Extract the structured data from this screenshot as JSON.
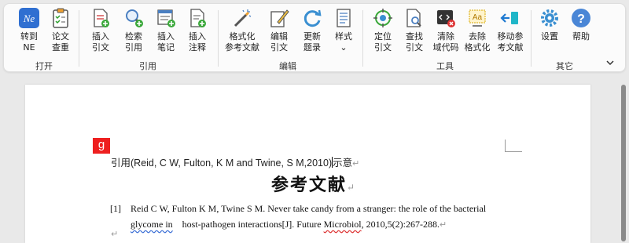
{
  "ribbon": {
    "groups": {
      "open": "打开",
      "cite": "引用",
      "edit": "编辑",
      "tools": "工具",
      "other": "其它"
    },
    "buttons": {
      "to_ne": "转到\nNE",
      "check_paper": "论文\n查重",
      "insert_cite": "插入\n引文",
      "search_cite": "检索\n引用",
      "insert_note": "插入\n笔记",
      "insert_annot": "插入\n注释",
      "format_refs": "格式化\n参考文献",
      "edit_cite": "编辑\n引文",
      "update_topics": "更新\n题录",
      "style": "样式\n⌄",
      "locate_cite": "定位\n引文",
      "find_cite": "查找\n引文",
      "clear_field": "清除\n域代码",
      "remove_format": "去除\n格式化",
      "move_refs": "移动参\n考文献",
      "settings": "设置",
      "help": "帮助"
    }
  },
  "document": {
    "field_marker": "g",
    "cite_line_pre": "引用(Reid, C W, Fulton, K M and Twine, S M,2010)",
    "cite_line_post": "示意",
    "para_mark": "↵",
    "heading": "参考文献",
    "ref_num": "[1]",
    "ref_text_1": "Reid C W, Fulton K M, Twine S M. Never take candy from a stranger: the role of the bacterial",
    "ref_text_2a": "glycome in",
    "ref_text_2b": "host-pathogen interactions[J]. Future ",
    "ref_text_2c": "Microbiol",
    "ref_text_2d": ", 2010,5(2):267-288."
  },
  "colors": {
    "field_marker_bg": "#ee1f1f",
    "ne_icon": "#2f6fd1"
  }
}
